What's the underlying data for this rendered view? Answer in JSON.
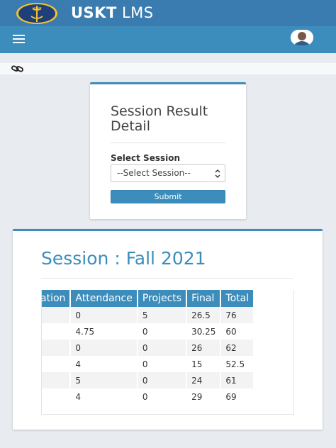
{
  "header": {
    "brand_bold": "USKT",
    "brand_light": "LMS",
    "logo_text": "USKT"
  },
  "card": {
    "title": "Session Result Detail",
    "select_label": "Select Session",
    "select_value": "--Select Session--",
    "submit_label": "Submit"
  },
  "result": {
    "session_title": "Session : Fall 2021",
    "columns": [
      "Participation",
      "Attendance",
      "Projects",
      "Final",
      "Total"
    ],
    "rows": [
      [
        "",
        "0",
        "5",
        "26.5",
        "76"
      ],
      [
        "",
        "4.75",
        "0",
        "30.25",
        "60"
      ],
      [
        "",
        "0",
        "0",
        "26",
        "62"
      ],
      [
        "",
        "4",
        "0",
        "15",
        "52.5"
      ],
      [
        "",
        "5",
        "0",
        "24",
        "61"
      ],
      [
        "",
        "4",
        "0",
        "29",
        "69"
      ]
    ]
  },
  "colors": {
    "primary": "#3c8dbc",
    "topbar": "#3a7bb0",
    "background": "#e8ecf1"
  },
  "icons": [
    "university-logo-icon",
    "hamburger-menu-icon",
    "user-avatar-icon",
    "link-icon",
    "select-arrows-icon"
  ]
}
